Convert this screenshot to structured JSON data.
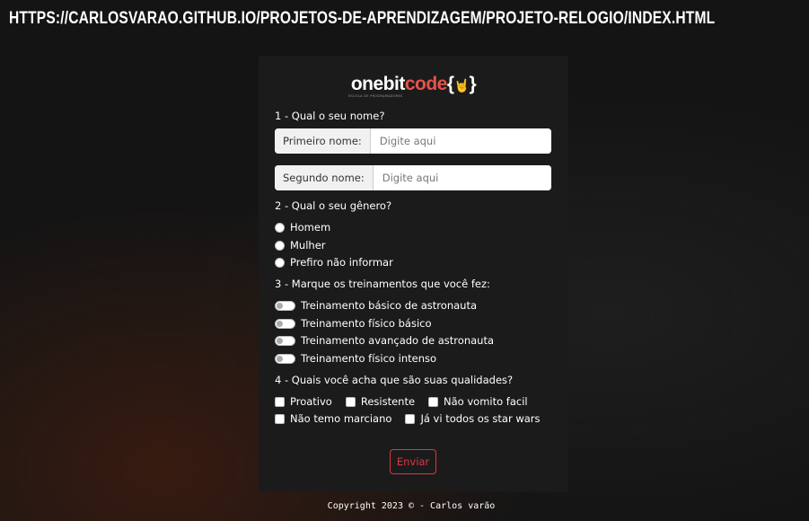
{
  "browser": {
    "url": "HTTPS://CARLOSVARAO.GITHUB.IO/PROJETOS-DE-APRENDIZAGEM/PROJETO-RELOGIO/INDEX.HTML"
  },
  "logo": {
    "one": "onebit",
    "code": "code",
    "brace_open": "{",
    "brace_close": "}",
    "hand": "🤘",
    "tagline": "ESCOLA DE PROGRAMADORES"
  },
  "form": {
    "q1": "1 - Qual o seu nome?",
    "first_name": {
      "label": "Primeiro nome:",
      "placeholder": "Digite aqui"
    },
    "last_name": {
      "label": "Segundo nome:",
      "placeholder": "Digite aqui"
    },
    "q2": "2 - Qual o seu gênero?",
    "gender_options": [
      "Homem",
      "Mulher",
      "Prefiro não informar"
    ],
    "q3": "3 - Marque os treinamentos que você fez:",
    "trainings": [
      "Treinamento básico de astronauta",
      "Treinamento físico básico",
      "Treinamento avançado de astronauta",
      "Treinamento físico intenso"
    ],
    "q4": "4 - Quais você acha que são suas qualidades?",
    "qualities": [
      "Proativo",
      "Resistente",
      "Não vomito facil",
      "Não temo marciano",
      "Já vi todos os star wars"
    ],
    "submit": "Enviar"
  },
  "footer": {
    "text": "Copyright 2023 © - Carlos varão"
  },
  "colors": {
    "accent": "#dc3545",
    "background": "#141414",
    "card": "#1c1b1b"
  }
}
